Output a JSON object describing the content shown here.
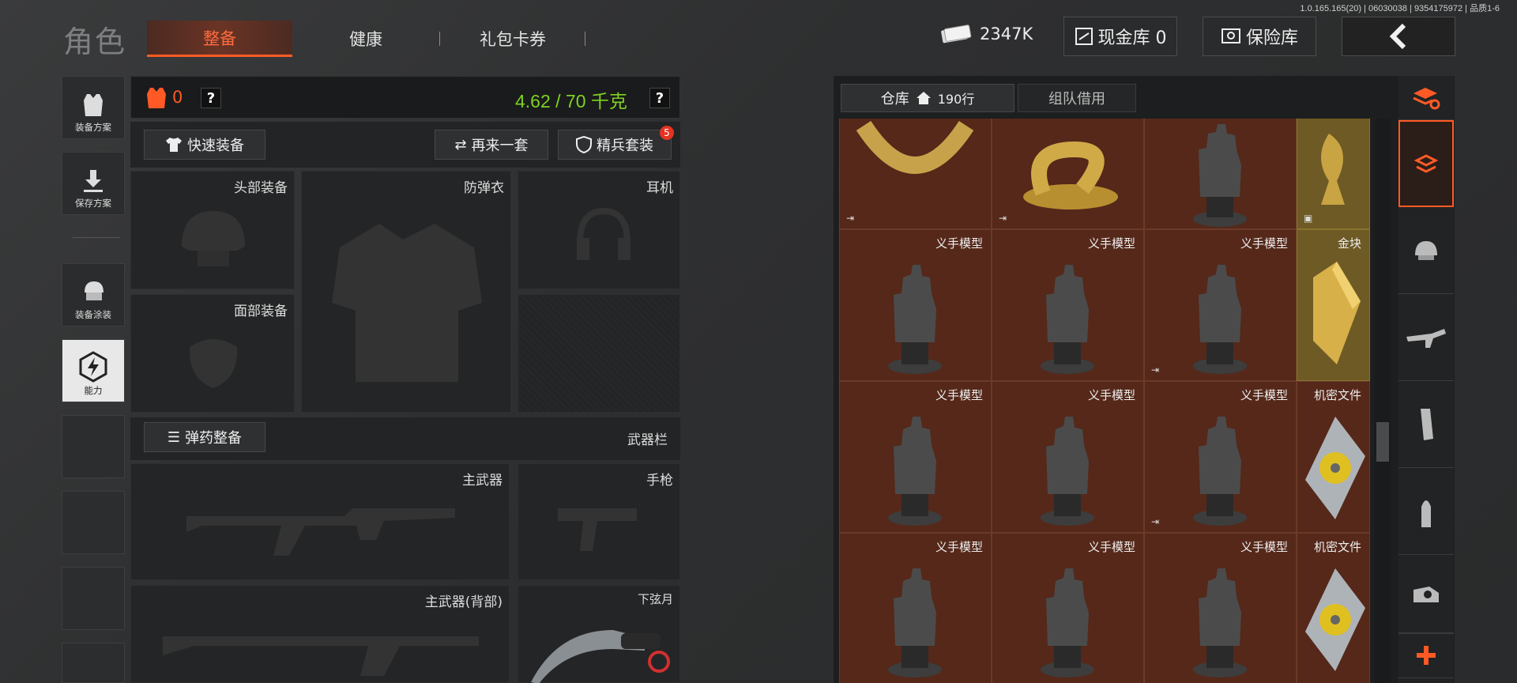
{
  "version": "1.0.165.165(20) | 06030038 | 9354175972 | 品质1-6",
  "header": {
    "title": "角色",
    "tabs": [
      {
        "label": "整备",
        "active": true
      },
      {
        "label": "健康"
      },
      {
        "label": "礼包卡券"
      }
    ],
    "currency": "2347K",
    "cash_vault": "现金库 0",
    "safe": "保险库",
    "back_icon": "chevron-left-icon"
  },
  "left_nav": [
    {
      "label": "装备方案",
      "icon": "vest-icon"
    },
    {
      "label": "保存方案",
      "icon": "download-icon"
    },
    {
      "label": "装备涂装",
      "icon": "helmet-skin-icon"
    },
    {
      "label": "能力",
      "icon": "lightning-hex-icon",
      "active": true
    }
  ],
  "loadout": {
    "armor_count": "0",
    "weight": "4.62 / 70 千克",
    "quick_equip": "快速装备",
    "again": "再来一套",
    "elite_set": "精兵套装",
    "elite_badge": "5",
    "slots": {
      "head": "头部装备",
      "vest": "防弹衣",
      "ear": "耳机",
      "face": "面部装备"
    },
    "ammo": "弹药整备",
    "weapon_bar": "武器栏",
    "weapons": {
      "primary": "主武器",
      "pistol": "手枪",
      "primary_back": "主武器(背部)",
      "melee": "下弦月"
    }
  },
  "storage": {
    "tab_storage": "仓库",
    "rows": "190行",
    "tab_team": "组队借用",
    "items_row1": [
      {
        "label": ""
      },
      {
        "label": ""
      },
      {
        "label": ""
      },
      {
        "label": "",
        "gold": true
      }
    ],
    "items": [
      [
        "义手模型",
        "义手模型",
        "义手模型",
        "金块"
      ],
      [
        "义手模型",
        "义手模型",
        "义手模型",
        "机密文件"
      ],
      [
        "义手模型",
        "义手模型",
        "义手模型",
        "机密文件"
      ]
    ]
  },
  "right_nav": [
    "layers-icon",
    "helmet-icon",
    "rifle-icon",
    "magazine-icon",
    "bullet-icon",
    "scope-icon"
  ],
  "colors": {
    "accent": "#ff5a26",
    "weight": "#7ed321",
    "cell": "#55281a"
  }
}
